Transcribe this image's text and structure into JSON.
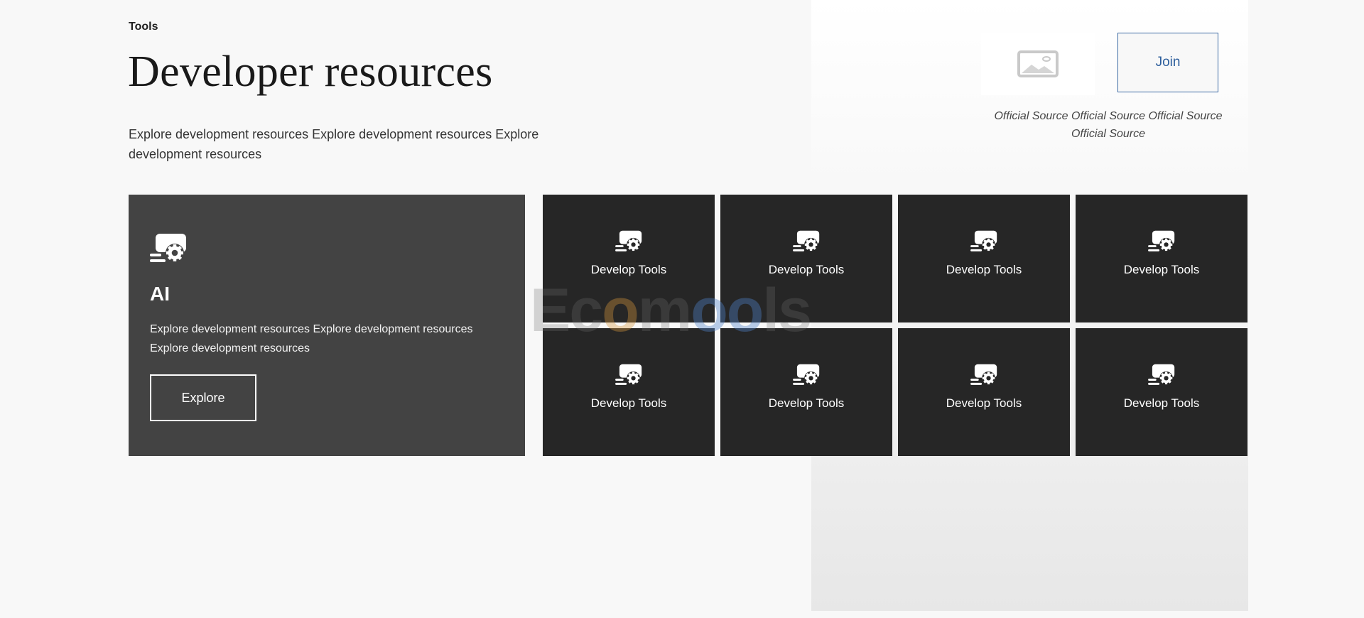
{
  "header": {
    "eyebrow": "Tools",
    "title": "Developer resources",
    "intro": "Explore development resources Explore development resources Explore development resources"
  },
  "aside": {
    "image_icon": "image-placeholder-icon",
    "join_label": "Join",
    "source_text": "Official Source Official Source Official Source Official Source",
    "join_color": "#2e5f9d"
  },
  "feature": {
    "icon": "screen-gear-icon",
    "title": "AI",
    "description": "Explore development resources Explore development resources Explore development resources",
    "button_label": "Explore"
  },
  "tiles": [
    {
      "label": "Develop Tools",
      "icon": "screen-gear-icon"
    },
    {
      "label": "Develop Tools",
      "icon": "screen-gear-icon"
    },
    {
      "label": "Develop Tools",
      "icon": "screen-gear-icon"
    },
    {
      "label": "Develop Tools",
      "icon": "screen-gear-icon"
    },
    {
      "label": "Develop Tools",
      "icon": "screen-gear-icon"
    },
    {
      "label": "Develop Tools",
      "icon": "screen-gear-icon"
    },
    {
      "label": "Develop Tools",
      "icon": "screen-gear-icon"
    },
    {
      "label": "Develop Tools",
      "icon": "screen-gear-icon"
    }
  ],
  "watermark": {
    "part1": "Ec",
    "part2": "o",
    "part3": "m",
    "part4": "oo",
    "part5": "ls"
  },
  "colors": {
    "card_dark": "#434343",
    "tile_dark": "#262626",
    "background": "#f8f8f8"
  }
}
